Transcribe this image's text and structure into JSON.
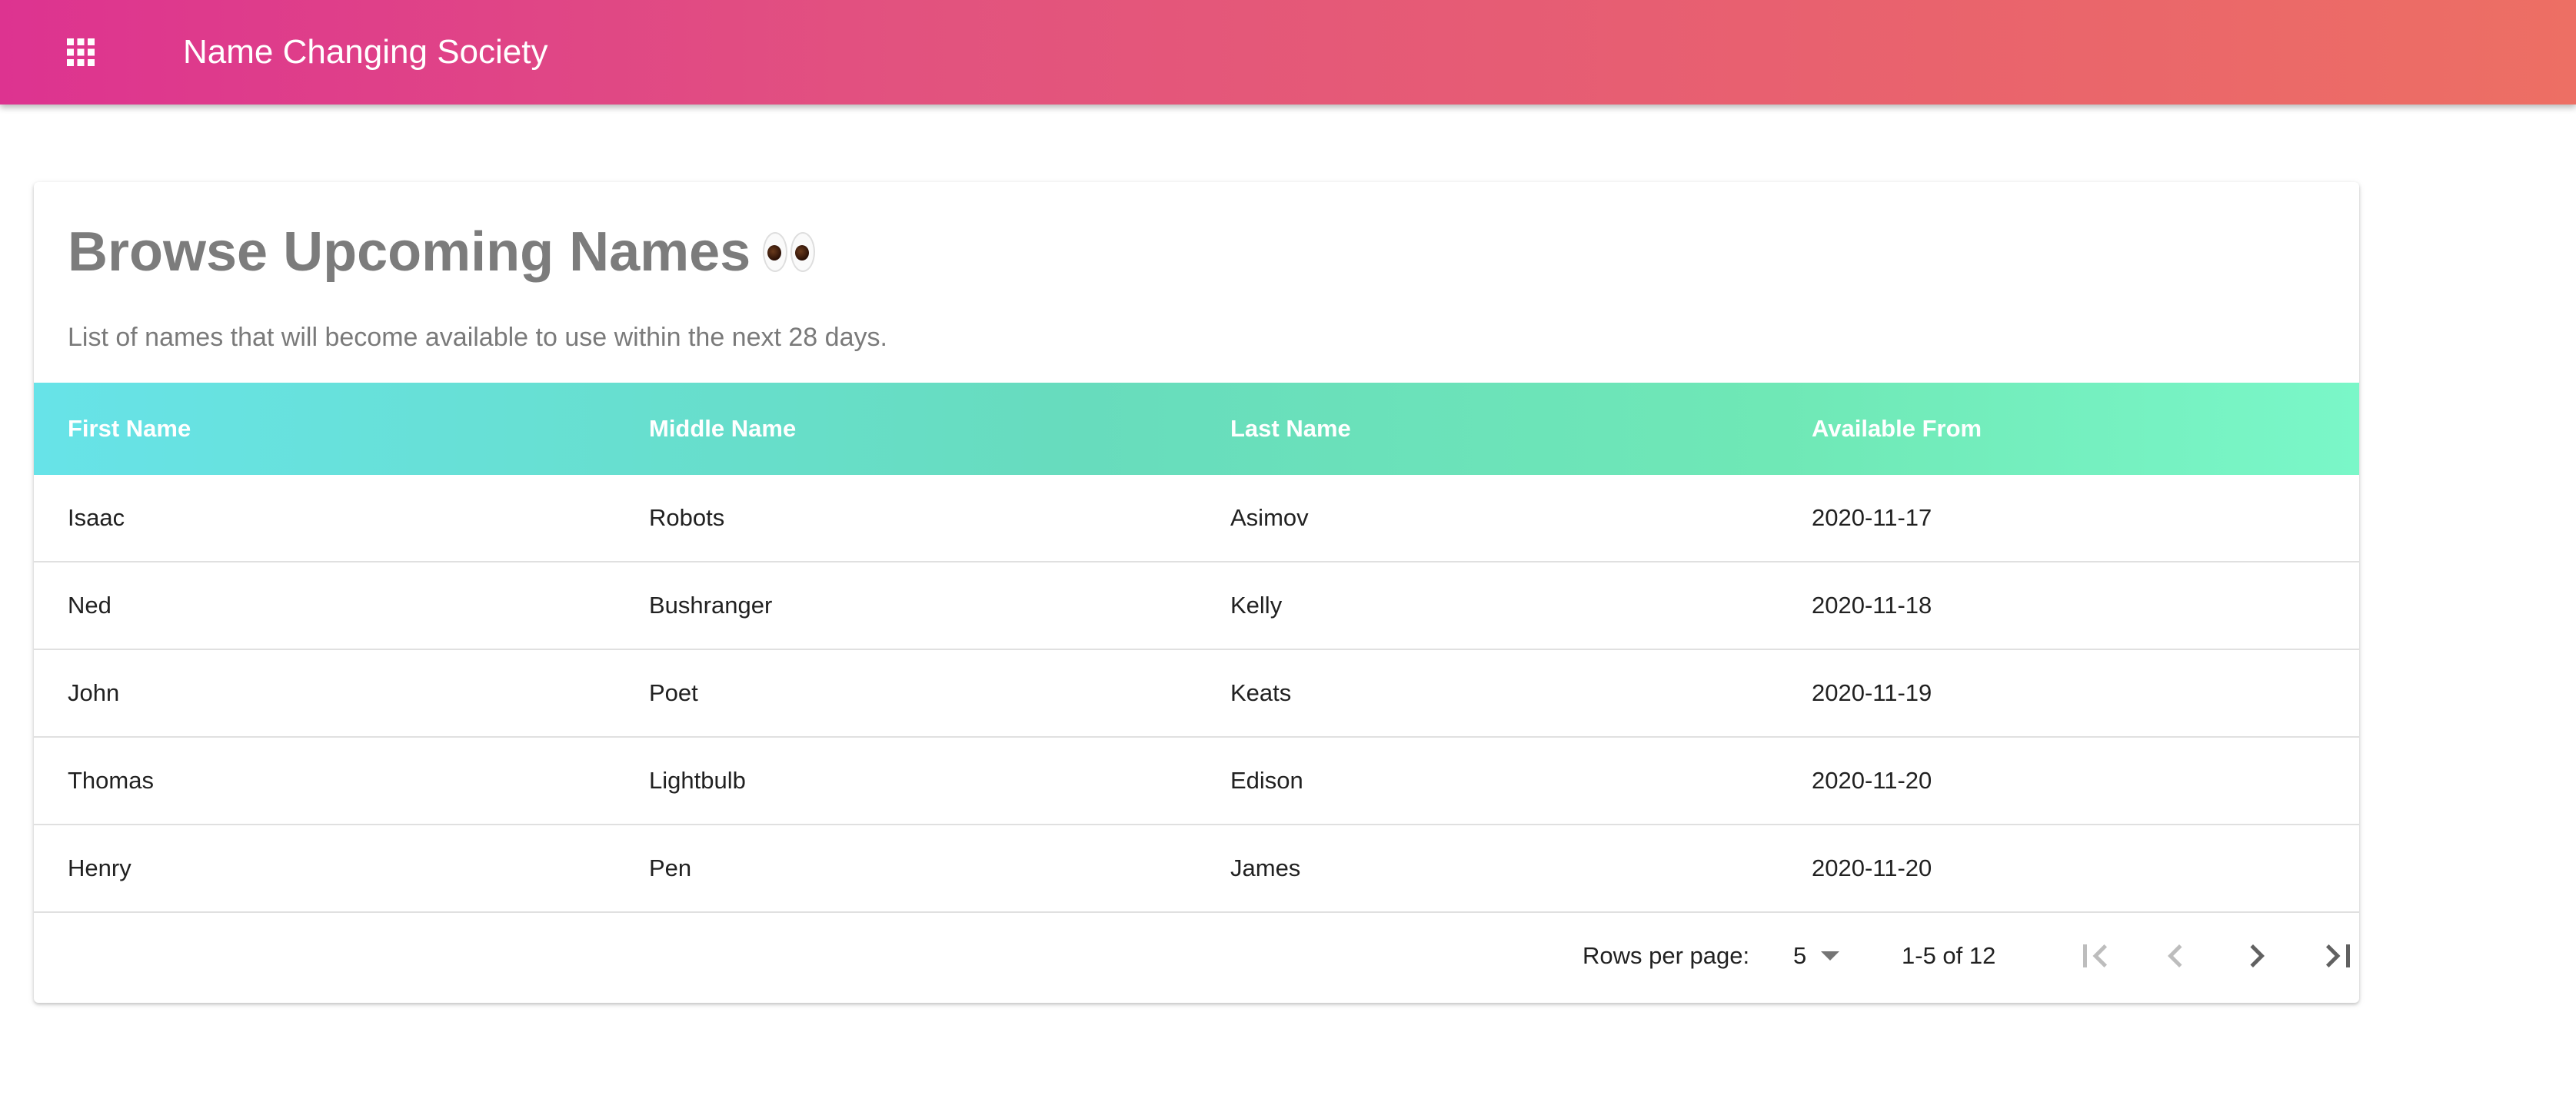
{
  "app_bar": {
    "title": "Name Changing Society",
    "menu_icon": "apps-grid-icon",
    "gradient_start": "#dd3390",
    "gradient_end": "#ed6f64"
  },
  "card": {
    "title": "Browse Upcoming Names",
    "title_emoji": "eyes-emoji",
    "subtitle": "List of names that will become available to use within the next 28 days."
  },
  "table": {
    "header_gradient_start": "#67e3e8",
    "header_gradient_end": "#7af7c8",
    "columns": [
      "First Name",
      "Middle Name",
      "Last Name",
      "Available From"
    ],
    "rows": [
      [
        "Isaac",
        "Robots",
        "Asimov",
        "2020-11-17"
      ],
      [
        "Ned",
        "Bushranger",
        "Kelly",
        "2020-11-18"
      ],
      [
        "John",
        "Poet",
        "Keats",
        "2020-11-19"
      ],
      [
        "Thomas",
        "Lightbulb",
        "Edison",
        "2020-11-20"
      ],
      [
        "Henry",
        "Pen",
        "James",
        "2020-11-20"
      ]
    ]
  },
  "pagination": {
    "rows_per_page_label": "Rows per page:",
    "rows_per_page_value": "5",
    "range_text": "1-5 of 12",
    "buttons": [
      "first-page-icon",
      "previous-page-icon",
      "next-page-icon",
      "last-page-icon"
    ]
  }
}
